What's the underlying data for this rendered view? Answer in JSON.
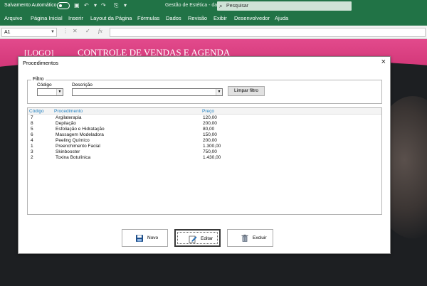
{
  "excel": {
    "autosave_label": "Salvamento Automático",
    "document_title": "Gestão de Estética - dados",
    "search_placeholder": "Pesquisar",
    "ribbon_tabs": [
      "Arquivo",
      "Página Inicial",
      "Inserir",
      "Layout da Página",
      "Fórmulas",
      "Dados",
      "Revisão",
      "Exibir",
      "Desenvolvedor",
      "Ajuda"
    ],
    "name_box": "A1",
    "fx": "fx",
    "accent_color": "#217346"
  },
  "sheet": {
    "logo": "[LOGO]",
    "title": "CONTROLE DE VENDAS E  AGENDA",
    "band_color": "#d13576"
  },
  "dialog": {
    "title": "Procedimentos",
    "close": "×",
    "filter": {
      "legend": "Filtro",
      "codigo_label": "Código",
      "codigo_value": "",
      "descricao_label": "Descrição",
      "descricao_value": "",
      "button_label": "Limpar filtro"
    },
    "table": {
      "columns": [
        "Código",
        "Procedimento",
        "Preço"
      ],
      "rows": [
        [
          "7",
          "Argilaterapia",
          "120,00"
        ],
        [
          "8",
          "Depilação",
          "200,00"
        ],
        [
          "5",
          "Esfoliação e Hidratação",
          "80,00"
        ],
        [
          "6",
          "Massagem Modeladora",
          "150,00"
        ],
        [
          "4",
          "Peeling Químico",
          "200,00"
        ],
        [
          "1",
          "Preenchimento Facial",
          "1.300,00"
        ],
        [
          "3",
          "Skinbooster",
          "750,00"
        ],
        [
          "2",
          "Toxina Botulínica",
          "1.430,00"
        ]
      ],
      "header_color": "#1f7fbf"
    },
    "buttons": {
      "novo": "Novo",
      "editar": "Editar",
      "excluir": "Excluir"
    }
  }
}
